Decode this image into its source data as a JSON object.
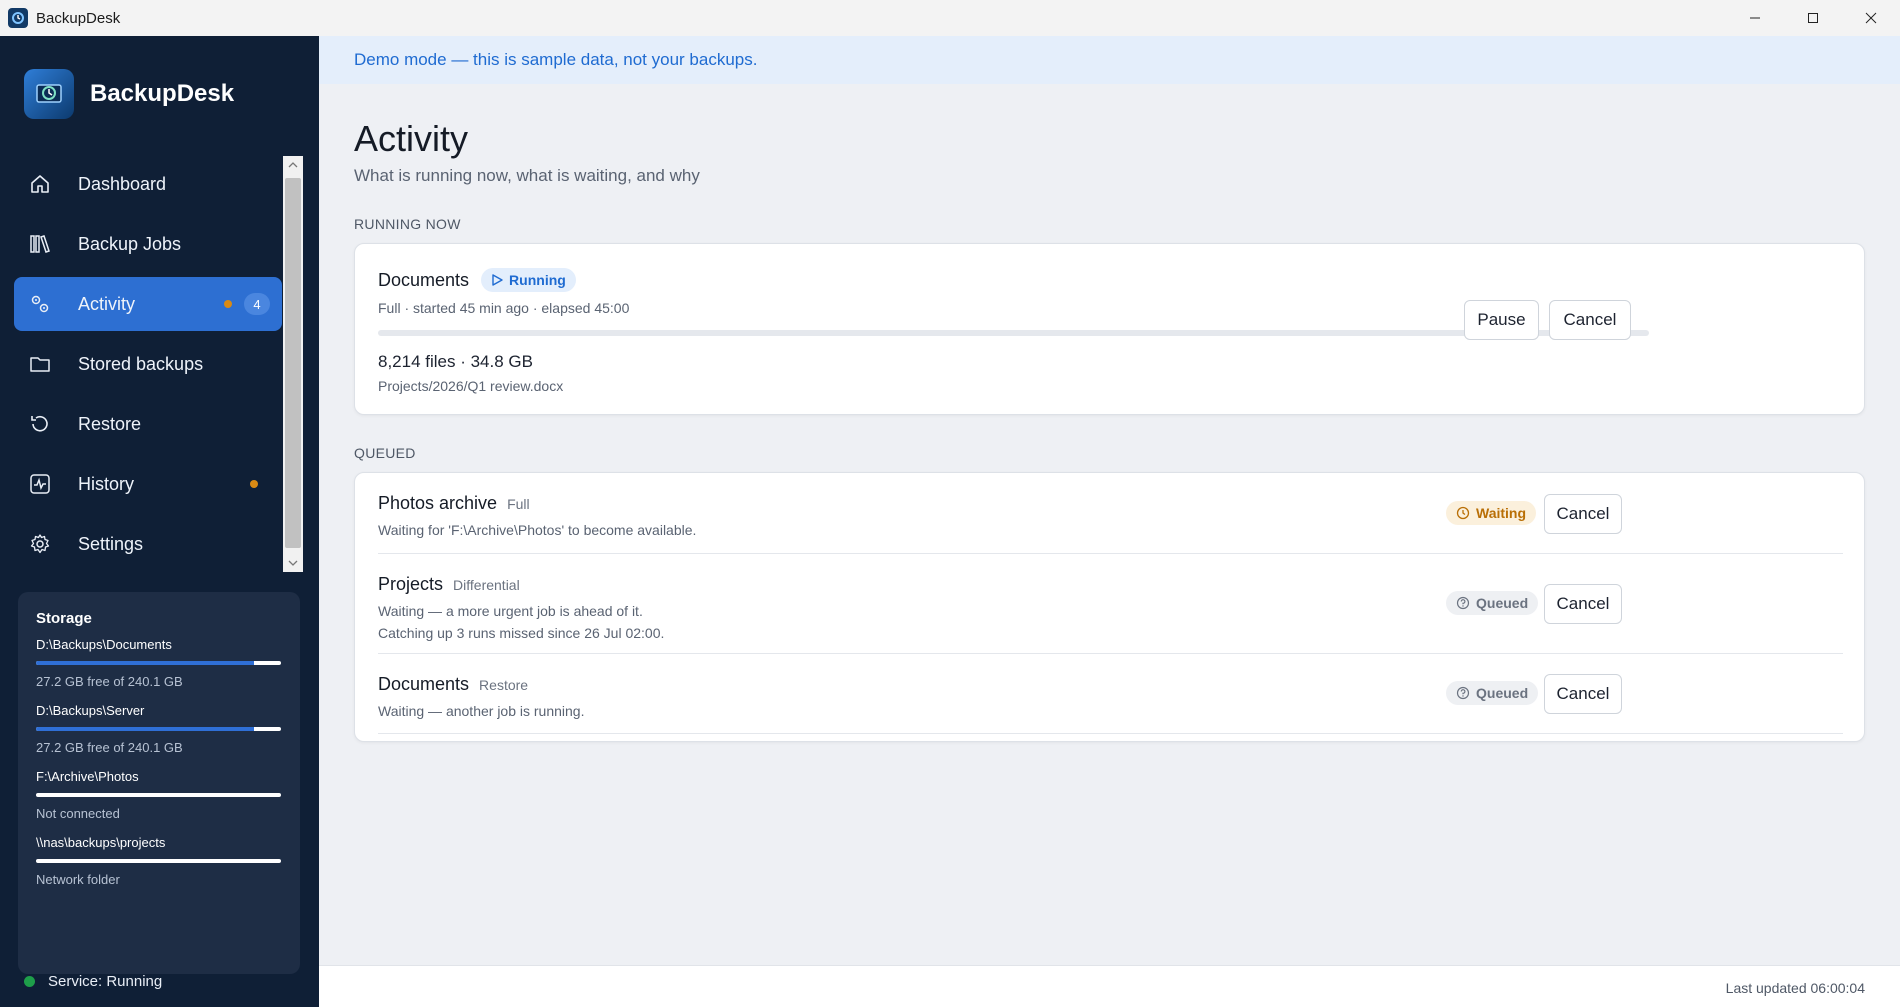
{
  "window": {
    "title": "BackupDesk",
    "controls": [
      "minimize",
      "maximize",
      "close"
    ]
  },
  "brand": {
    "name": "BackupDesk"
  },
  "nav": {
    "items": [
      {
        "label": "Dashboard",
        "icon": "home-icon"
      },
      {
        "label": "Backup Jobs",
        "icon": "books-icon"
      },
      {
        "label": "Activity",
        "icon": "gears-icon",
        "active": true,
        "badge": "4",
        "dot": true
      },
      {
        "label": "Stored backups",
        "icon": "folder-icon"
      },
      {
        "label": "Restore",
        "icon": "restore-icon"
      },
      {
        "label": "History",
        "icon": "activity-icon",
        "dot": true
      },
      {
        "label": "Settings",
        "icon": "gear-icon"
      }
    ]
  },
  "storage": {
    "title": "Storage",
    "items": [
      {
        "path": "D:\\Backups\\Documents",
        "sub": "27.2 GB free of 240.1 GB",
        "used_fraction": 0.89
      },
      {
        "path": "D:\\Backups\\Server",
        "sub": "27.2 GB free of 240.1 GB",
        "used_fraction": 0.89
      },
      {
        "path": "F:\\Archive\\Photos",
        "sub": "Not connected",
        "used_fraction": 0
      },
      {
        "path": "\\\\nas\\backups\\projects",
        "sub": "Network folder",
        "used_fraction": 0
      }
    ]
  },
  "service": {
    "label": "Service: Running",
    "color": "#1e9e4a"
  },
  "banner": {
    "text": "Demo mode — this is sample data, not your backups."
  },
  "page": {
    "title": "Activity",
    "subtitle": "What is running now, what is waiting, and why"
  },
  "running": {
    "section_label": "RUNNING NOW",
    "job": {
      "name": "Documents",
      "status": "Running",
      "meta": "Full · started 45 min ago · elapsed 45:00",
      "progress": 0,
      "counts": "8,214 files · 34.8 GB",
      "current_file": "Projects/2026/Q1 review.docx",
      "pause_label": "Pause",
      "cancel_label": "Cancel"
    }
  },
  "queued": {
    "section_label": "QUEUED",
    "jobs": [
      {
        "name": "Photos archive",
        "type": "Full",
        "lines": [
          "Waiting for 'F:\\Archive\\Photos' to become available."
        ],
        "status": "Waiting",
        "cancel_label": "Cancel"
      },
      {
        "name": "Projects",
        "type": "Differential",
        "lines": [
          "Waiting — a more urgent job is ahead of it.",
          "Catching up 3 runs missed since 26 Jul 02:00."
        ],
        "status": "Queued",
        "cancel_label": "Cancel"
      },
      {
        "name": "Documents",
        "type": "Restore",
        "lines": [
          "Waiting — another job is running."
        ],
        "status": "Queued",
        "cancel_label": "Cancel"
      }
    ]
  },
  "footer": {
    "updated": "Last updated 06:00:04"
  },
  "colors": {
    "sidebar_bg": "#0f1f36",
    "accent": "#2d6fd2",
    "warning": "#d98a14",
    "banner_text": "#1f6bd1"
  }
}
